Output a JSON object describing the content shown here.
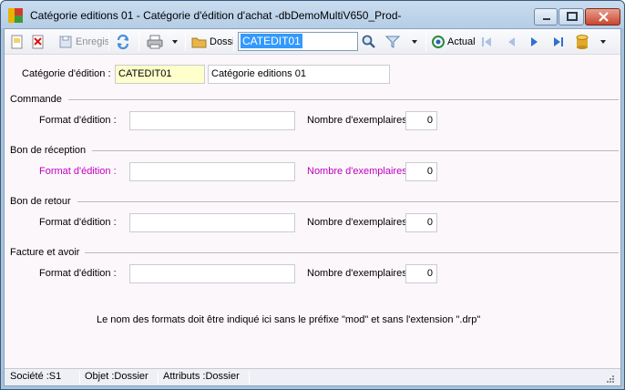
{
  "window": {
    "title": "Catégorie  editions 01 -  Catégorie d'édition d'achat -dbDemoMultiV650_Prod-"
  },
  "toolbar": {
    "save_label": "Enregis",
    "folder_label": "Dossi",
    "search_value": "CATEDIT01",
    "current_label": "Actual"
  },
  "header": {
    "category_label": "Catégorie d'édition :",
    "category_code": "CATEDIT01",
    "category_name": "Catégorie  editions 01"
  },
  "sections": [
    {
      "title": "Commande",
      "format_label": "Format d'édition :",
      "format_value": "",
      "copies_label": "Nombre d'exemplaires :",
      "copies_value": "0"
    },
    {
      "title": "Bon de réception",
      "format_label": "Format d'édition :",
      "format_value": "",
      "copies_label": "Nombre d'exemplaires :",
      "copies_value": "0"
    },
    {
      "title": "Bon de retour",
      "format_label": "Format d'édition :",
      "format_value": "",
      "copies_label": "Nombre d'exemplaires :",
      "copies_value": "0"
    },
    {
      "title": "Facture et avoir",
      "format_label": "Format d'édition :",
      "format_value": "",
      "copies_label": "Nombre d'exemplaires :",
      "copies_value": "0"
    }
  ],
  "note": "Le nom des formats doit être indiqué ici sans le préfixe \"mod\" et sans l'extension \".drp\"",
  "statusbar": {
    "company": "Société :S1",
    "object": "Objet :Dossier",
    "attributes": "Attributs :Dossier"
  },
  "colors": {
    "highlight_label": "#c000c0",
    "key_field_bg": "#ffffcc",
    "selection": "#3399ff"
  }
}
